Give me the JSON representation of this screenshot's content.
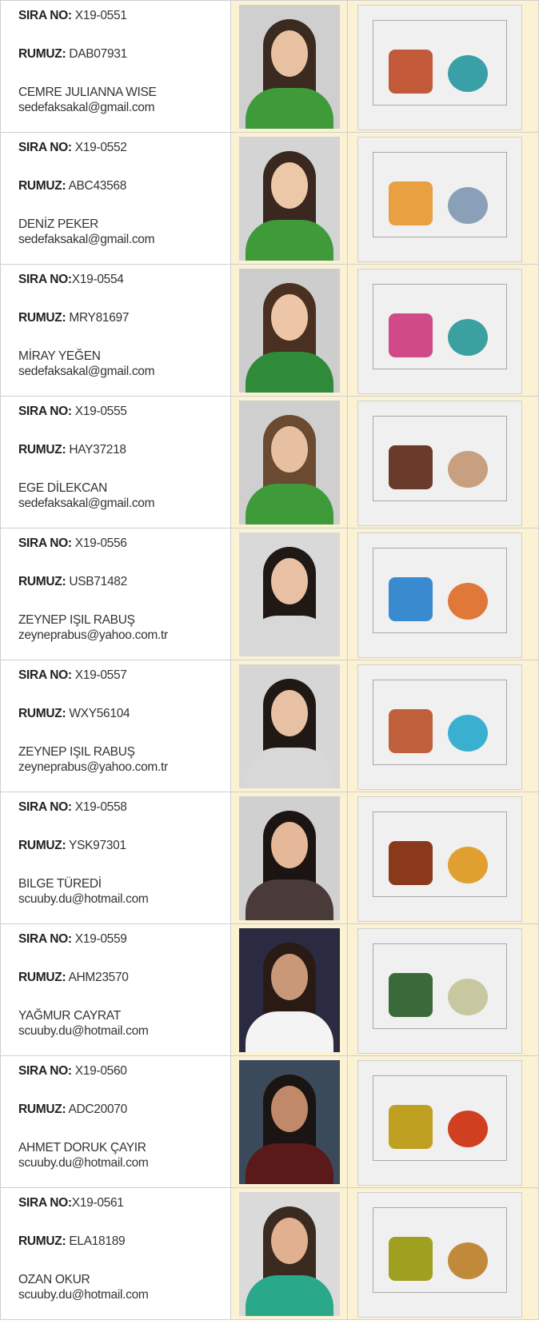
{
  "entries": [
    {
      "sira_label": "SIRA NO:",
      "sira_value": " X19-0551",
      "rumuz_label": "RUMUZ:",
      "rumuz_value": " DAB07931",
      "name": "CEMRE JULIANNA WISE",
      "email": "sedefaksakal@gmail.com"
    },
    {
      "sira_label": "SIRA NO:",
      "sira_value": " X19-0552",
      "rumuz_label": "RUMUZ:",
      "rumuz_value": " ABC43568",
      "name": "DENİZ PEKER",
      "email": "sedefaksakal@gmail.com"
    },
    {
      "sira_label": "SIRA NO:",
      "sira_value": "X19-0554",
      "rumuz_label": "RUMUZ:",
      "rumuz_value": " MRY81697",
      "name": "MİRAY YEĞEN",
      "email": "sedefaksakal@gmail.com"
    },
    {
      "sira_label": "SIRA NO:",
      "sira_value": " X19-0555",
      "rumuz_label": "RUMUZ:",
      "rumuz_value": " HAY37218",
      "name": "EGE DİLEKCAN",
      "email": "sedefaksakal@gmail.com"
    },
    {
      "sira_label": "SIRA NO:",
      "sira_value": " X19-0556",
      "rumuz_label": "RUMUZ:",
      "rumuz_value": " USB71482",
      "name": "ZEYNEP IŞIL RABUŞ",
      "email": "zeyneprabus@yahoo.com.tr"
    },
    {
      "sira_label": "SIRA NO:",
      "sira_value": " X19-0557",
      "rumuz_label": "RUMUZ:",
      "rumuz_value": " WXY56104",
      "name": "ZEYNEP IŞIL RABUŞ",
      "email": "zeyneprabus@yahoo.com.tr"
    },
    {
      "sira_label": "SIRA NO:",
      "sira_value": " X19-0558",
      "rumuz_label": "RUMUZ:",
      "rumuz_value": " YSK97301",
      "name": "BILGE TÜREDİ",
      "email": "scuuby.du@hotmail.com"
    },
    {
      "sira_label": "SIRA NO:",
      "sira_value": " X19-0559",
      "rumuz_label": "RUMUZ:",
      "rumuz_value": " AHM23570",
      "name": "YAĞMUR CAYRAT",
      "email": "scuuby.du@hotmail.com"
    },
    {
      "sira_label": "SIRA NO:",
      "sira_value": " X19-0560",
      "rumuz_label": "RUMUZ:",
      "rumuz_value": " ADC20070",
      "name": "AHMET DORUK ÇAYIR",
      "email": "scuuby.du@hotmail.com"
    },
    {
      "sira_label": "SIRA NO:",
      "sira_value": "X19-0561",
      "rumuz_label": "RUMUZ:",
      "rumuz_value": " ELA18189",
      "name": "OZAN OKUR",
      "email": "scuuby.du@hotmail.com"
    }
  ],
  "colors": {
    "cell_background": "#fbf1d3",
    "border": "#cfcfcf",
    "text": "#333333"
  }
}
